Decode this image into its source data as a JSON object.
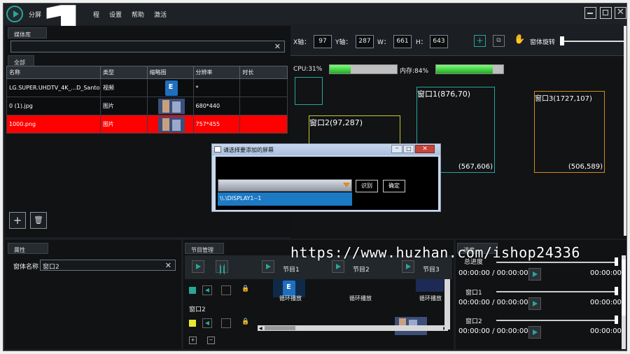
{
  "titlebar": {
    "menu": [
      "分屏",
      "",
      "程",
      "设置",
      "帮助",
      "激活"
    ],
    "big_glyph": "1"
  },
  "media_library": {
    "tab_label": "媒体库",
    "search_value": "",
    "filter_tab": "全部",
    "columns": [
      "名称",
      "类型",
      "缩略图",
      "分辨率",
      "时长"
    ],
    "rows": [
      {
        "name": "LG.SUPER.UHDTV_4K_...D_Santo",
        "type": "视频",
        "thumb": "doc",
        "resolution": "*",
        "duration": "",
        "selected": false
      },
      {
        "name": "0 (1).jpg",
        "type": "图片",
        "thumb": "image",
        "resolution": "680*440",
        "duration": "",
        "selected": false
      },
      {
        "name": "1000.png",
        "type": "图片",
        "thumb": "image",
        "resolution": "757*455",
        "duration": "",
        "selected": true
      }
    ],
    "add_label": "+",
    "delete_label": "🗑"
  },
  "geometry_bar": {
    "x_label": "X轴：",
    "x_value": "97",
    "y_label": "Y轴：",
    "y_value": "287",
    "w_label": "W：",
    "w_value": "661",
    "h_label": "H：",
    "h_value": "643",
    "rotate_label": "窗体旋转"
  },
  "stats": {
    "cpu_label": "CPU:31%",
    "cpu_percent": 31,
    "mem_label": "内存:84%",
    "mem_percent": 84
  },
  "windows": [
    {
      "title": "窗口2(97,287)",
      "size": ""
    },
    {
      "title": "窗口1(876,70)",
      "size": "(567,606)"
    },
    {
      "title": "窗口3(1727,107)",
      "size": "(506,589)"
    }
  ],
  "dialog": {
    "title": "请选择要添加的屏幕",
    "option": "\\\\.\\DISPLAY1--1",
    "identify_label": "识别",
    "confirm_label": "确定"
  },
  "properties": {
    "tab_label": "属性",
    "name_label": "窗体名称",
    "name_value": "窗口2"
  },
  "program": {
    "tab_label": "节目管理",
    "programs": [
      "节目1",
      "节目2",
      "节目3"
    ],
    "loop_label": "循环播放",
    "window_label": "窗口2"
  },
  "timeline": {
    "tab_label": "进度",
    "total_label": "总进度",
    "total_time": "00:00:00 / 00:00:00",
    "total_end": "00:00:00",
    "items": [
      {
        "label": "窗口1",
        "time": "00:00:00 / 00:00:00",
        "end": "00:00:00"
      },
      {
        "label": "窗口2",
        "time": "00:00:00 / 00:00:00",
        "end": "00:00:00"
      }
    ]
  },
  "watermark": "https://www.huzhan.com/ishop24336",
  "colors": {
    "accent": "#2aa59a",
    "selected_row": "#ff0000",
    "window_outline_a": "#c8c832",
    "window_outline_b": "#2aa59a",
    "window_outline_c": "#d88a18"
  }
}
